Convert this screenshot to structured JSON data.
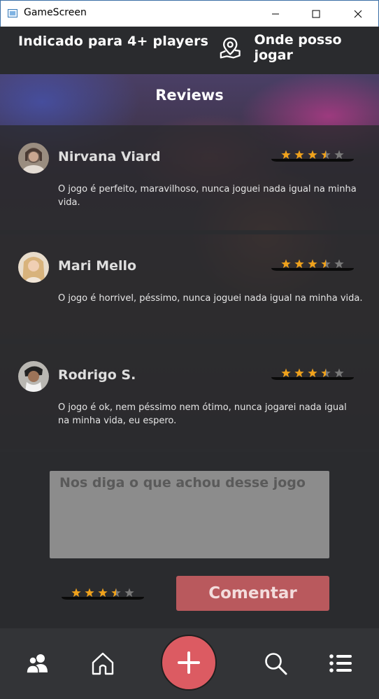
{
  "window": {
    "title": "GameScreen"
  },
  "info": {
    "players": "Indicado para 4+ players",
    "where_to_play": "Onde posso jogar"
  },
  "reviews_section": {
    "title": "Reviews"
  },
  "reviews": [
    {
      "name": "Nirvana Viard",
      "rating": 3.5,
      "text": "O jogo é perfeito, maravilhoso, nunca joguei nada igual na minha vida."
    },
    {
      "name": "Mari Mello",
      "rating": 3.5,
      "text": "O jogo é horrivel, péssimo, nunca joguei nada igual na minha vida."
    },
    {
      "name": "Rodrigo S.",
      "rating": 3.5,
      "text": "O jogo é ok, nem péssimo nem ótimo, nunca jogarei nada igual\n na minha vida, eu espero."
    }
  ],
  "comment": {
    "placeholder": "Nos diga o que achou desse jogo",
    "rating": 3.5,
    "button_label": "Comentar"
  },
  "colors": {
    "accent": "#dc5b62",
    "button": "#b9595d",
    "star": "#f0a21c",
    "star_empty": "#7a7a7a"
  },
  "nav": {
    "items": [
      "users-icon",
      "home-icon",
      "plus-icon",
      "search-icon",
      "list-icon"
    ]
  }
}
